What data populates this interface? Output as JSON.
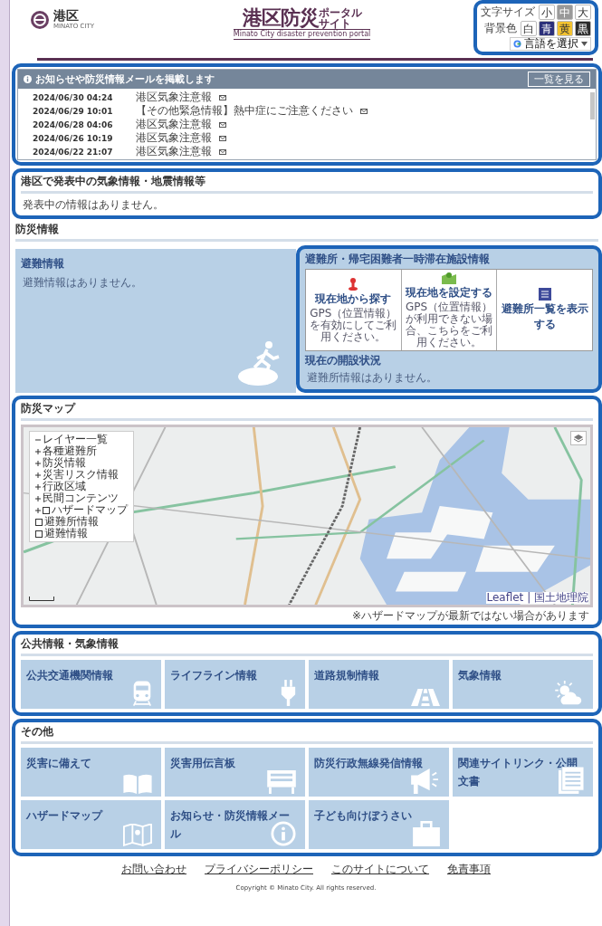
{
  "header": {
    "logo_text": "港区",
    "logo_sub": "MINATO CITY",
    "title": "港区防災",
    "title_top": "ポータル",
    "title_bottom": "サイト",
    "subtitle": "Minato City disaster prevention portal",
    "font_size_label": "文字サイズ",
    "font_sizes": [
      {
        "label": "小",
        "selected": false
      },
      {
        "label": "中",
        "selected": true
      },
      {
        "label": "大",
        "selected": false
      }
    ],
    "bg_label": "背景色",
    "bg_colors": [
      {
        "label": "白",
        "color": "#ffffff"
      },
      {
        "label": "青",
        "color": "#2b2f7a"
      },
      {
        "label": "黄",
        "color": "#f2c230"
      },
      {
        "label": "黒",
        "color": "#2a2a2a"
      }
    ],
    "language": "言語を選択"
  },
  "notices": {
    "title": "お知らせや防災情報メールを掲載します",
    "list_button": "一覧を見る",
    "items": [
      {
        "date": "2024/06/30 04:24",
        "text": "港区気象注意報"
      },
      {
        "date": "2024/06/29 10:01",
        "text": "【その他緊急情報】熱中症にご注意ください"
      },
      {
        "date": "2024/06/28 04:06",
        "text": "港区気象注意報"
      },
      {
        "date": "2024/06/26 10:19",
        "text": "港区気象注意報"
      },
      {
        "date": "2024/06/22 21:07",
        "text": "港区気象注意報"
      }
    ]
  },
  "alert": {
    "title": "港区で発表中の気象情報・地震情報等",
    "message": "発表中の情報はありません。"
  },
  "disaster": {
    "title": "防災情報",
    "evacuation": {
      "title": "避難情報",
      "message": "避難情報はありません。"
    },
    "shelter": {
      "title": "避難所・帰宅困難者一時滞在施設情報",
      "actions": [
        {
          "kind": "locate",
          "label": "現在地から探す",
          "note": "GPS（位置情報）を有効にしてご利用ください。"
        },
        {
          "kind": "set",
          "label": "現在地を設定する",
          "note": "GPS（位置情報）が利用できない場合、こちらをご利用ください。"
        },
        {
          "kind": "list",
          "label": "避難所一覧を表示する"
        }
      ],
      "status_title": "現在の開設状況",
      "status_message": "避難所情報はありません。"
    }
  },
  "map": {
    "title": "防災マップ",
    "layers": [
      {
        "kind": "group",
        "label": "レイヤー一覧"
      },
      {
        "kind": "expand",
        "label": "各種避難所"
      },
      {
        "kind": "expand",
        "label": "防災情報"
      },
      {
        "kind": "expand",
        "label": "災害リスク情報"
      },
      {
        "kind": "expand",
        "label": "行政区域"
      },
      {
        "kind": "expand",
        "label": "民間コンテンツ"
      },
      {
        "kind": "expand-checkbox",
        "label": "ハザードマップ",
        "checked": false
      },
      {
        "kind": "checkbox",
        "label": "避難所情報",
        "checked": false
      },
      {
        "kind": "checkbox",
        "label": "避難情報",
        "checked": false
      }
    ],
    "attribution": "Leaflet | 国土地理院",
    "note": "※ハザードマップが最新ではない場合があります"
  },
  "public_info": {
    "title": "公共情報・気象情報",
    "tiles": [
      {
        "label": "公共交通機関情報",
        "kind": "train"
      },
      {
        "label": "ライフライン情報",
        "kind": "plug"
      },
      {
        "label": "道路規制情報",
        "kind": "road"
      },
      {
        "label": "気象情報",
        "kind": "weather"
      }
    ]
  },
  "other": {
    "title": "その他",
    "tiles": [
      {
        "label": "災害に備えて",
        "kind": "book"
      },
      {
        "label": "災害用伝言板",
        "kind": "board"
      },
      {
        "label": "防災行政無線発信情報",
        "kind": "megaphone"
      },
      {
        "label": "関連サイトリンク・公開文書",
        "kind": "document"
      },
      {
        "label": "ハザードマップ",
        "kind": "map"
      },
      {
        "label": "お知らせ・防災情報メール",
        "kind": "info"
      },
      {
        "label": "子ども向けぼうさい",
        "kind": "bag"
      }
    ]
  },
  "footer": {
    "links": [
      "お問い合わせ",
      "プライバシーポリシー",
      "このサイトについて",
      "免責事項"
    ],
    "copyright": "Copyright © Minato City. All rights reserved."
  }
}
